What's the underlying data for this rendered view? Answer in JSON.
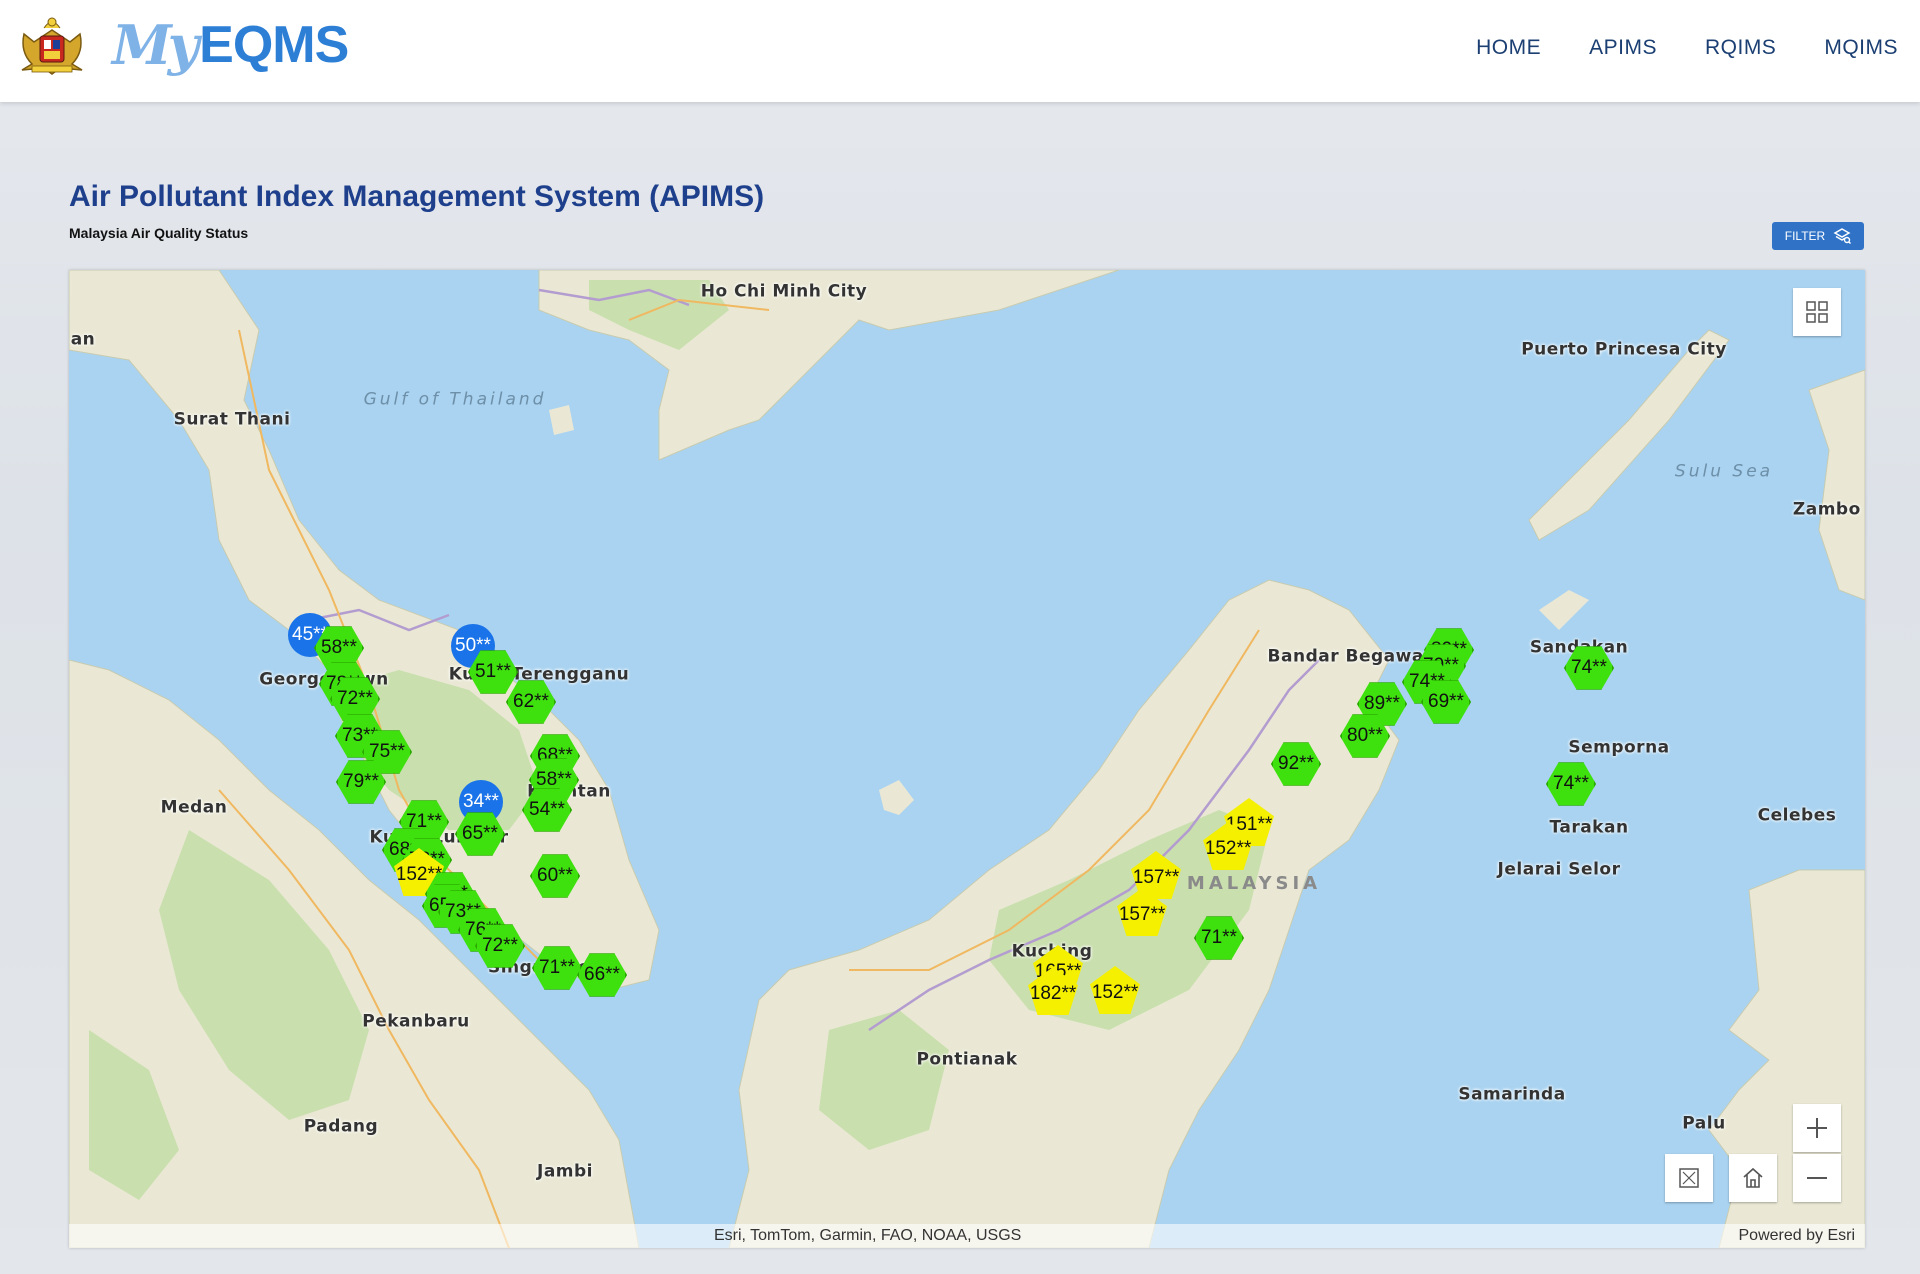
{
  "header": {
    "logo_prefix": "My",
    "logo_name": "EQMS",
    "nav": [
      "HOME",
      "APIMS",
      "RQIMS",
      "MQIMS"
    ]
  },
  "page": {
    "title": "Air Pollutant Index Management System (APIMS)",
    "subtitle": "Malaysia Air Quality Status",
    "filter_label": "FILTER"
  },
  "map": {
    "place_labels": {
      "cities": [
        "Ho Chi Minh City",
        "Surat Thani",
        "Puerto Princesa City",
        "Zambo Cit",
        "Sandakan",
        "Semporna",
        "Tarakan",
        "Jelarai Selor",
        "Bandar Begawan",
        "Medan",
        "Pekanbaru",
        "Padang",
        "Jambi",
        "Pontianak",
        "Samarinda",
        "Palu",
        "Kuching",
        "George Town",
        "Kuala Terengganu",
        "Kuantan",
        "Kuala Lumpur",
        "Singapore",
        "an",
        "Celebes"
      ],
      "seas": [
        "Gulf of Thailand",
        "Sulu Sea"
      ],
      "countries": [
        "MALAYSIA"
      ]
    },
    "legend_colors": {
      "good": "#3ee00e",
      "moderate": "#f4f000",
      "excellent": "#1a73e8"
    },
    "stations": [
      {
        "api": "45**",
        "shape": "circle",
        "color": "blue"
      },
      {
        "api": "58**",
        "shape": "hexagon",
        "color": "green"
      },
      {
        "api": "50**",
        "shape": "circle",
        "color": "blue"
      },
      {
        "api": "51**",
        "shape": "hexagon",
        "color": "green"
      },
      {
        "api": "78**",
        "shape": "hexagon",
        "color": "green"
      },
      {
        "api": "72**",
        "shape": "hexagon",
        "color": "green"
      },
      {
        "api": "62**",
        "shape": "hexagon",
        "color": "green"
      },
      {
        "api": "73**",
        "shape": "hexagon",
        "color": "green"
      },
      {
        "api": "75**",
        "shape": "hexagon",
        "color": "green"
      },
      {
        "api": "68**",
        "shape": "hexagon",
        "color": "green"
      },
      {
        "api": "58**",
        "shape": "hexagon",
        "color": "green"
      },
      {
        "api": "79**",
        "shape": "hexagon",
        "color": "green"
      },
      {
        "api": "34**",
        "shape": "circle",
        "color": "blue"
      },
      {
        "api": "54**",
        "shape": "hexagon",
        "color": "green"
      },
      {
        "api": "71**",
        "shape": "hexagon",
        "color": "green"
      },
      {
        "api": "65**",
        "shape": "hexagon",
        "color": "green"
      },
      {
        "api": "68**",
        "shape": "hexagon",
        "color": "green"
      },
      {
        "api": "78**",
        "shape": "hexagon",
        "color": "green"
      },
      {
        "api": "152**",
        "shape": "pentagon",
        "color": "yellow"
      },
      {
        "api": "60**",
        "shape": "hexagon",
        "color": "green"
      },
      {
        "api": "80**",
        "shape": "hexagon",
        "color": "green"
      },
      {
        "api": "65**",
        "shape": "hexagon",
        "color": "green"
      },
      {
        "api": "73**",
        "shape": "hexagon",
        "color": "green"
      },
      {
        "api": "76**",
        "shape": "hexagon",
        "color": "green"
      },
      {
        "api": "72**",
        "shape": "hexagon",
        "color": "green"
      },
      {
        "api": "71**",
        "shape": "hexagon",
        "color": "green"
      },
      {
        "api": "66**",
        "shape": "hexagon",
        "color": "green"
      },
      {
        "api": "89**",
        "shape": "hexagon",
        "color": "green"
      },
      {
        "api": "79**",
        "shape": "hexagon",
        "color": "green"
      },
      {
        "api": "74**",
        "shape": "hexagon",
        "color": "green"
      },
      {
        "api": "69**",
        "shape": "hexagon",
        "color": "green"
      },
      {
        "api": "89**",
        "shape": "hexagon",
        "color": "green"
      },
      {
        "api": "80**",
        "shape": "hexagon",
        "color": "green"
      },
      {
        "api": "92**",
        "shape": "hexagon",
        "color": "green"
      },
      {
        "api": "74**",
        "shape": "hexagon",
        "color": "green"
      },
      {
        "api": "74**",
        "shape": "hexagon",
        "color": "green"
      },
      {
        "api": "151**",
        "shape": "pentagon",
        "color": "yellow"
      },
      {
        "api": "152**",
        "shape": "pentagon",
        "color": "yellow"
      },
      {
        "api": "157**",
        "shape": "pentagon",
        "color": "yellow"
      },
      {
        "api": "157**",
        "shape": "pentagon",
        "color": "yellow"
      },
      {
        "api": "71**",
        "shape": "hexagon",
        "color": "green"
      },
      {
        "api": "165**",
        "shape": "pentagon",
        "color": "yellow"
      },
      {
        "api": "182**",
        "shape": "pentagon",
        "color": "yellow"
      },
      {
        "api": "152**",
        "shape": "pentagon",
        "color": "yellow"
      }
    ],
    "controls": {
      "basemap_gallery_icon": "grid-icon",
      "zoom_in_icon": "plus-icon",
      "zoom_out_icon": "minus-icon",
      "home_icon": "home-icon",
      "fullscreen_icon": "expand-icon"
    },
    "attribution": "Esri, TomTom, Garmin, FAO, NOAA, USGS",
    "powered_by": "Powered by Esri"
  }
}
